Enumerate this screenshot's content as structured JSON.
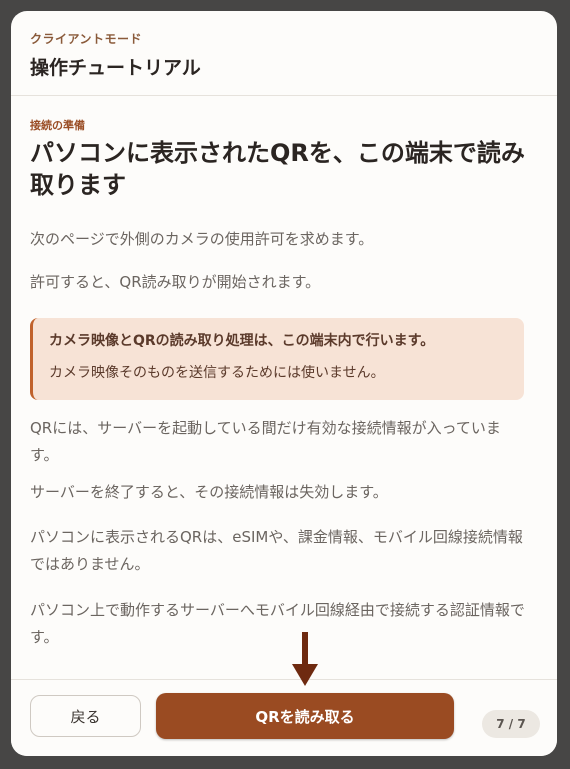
{
  "header": {
    "mode_label": "クライアントモード",
    "title": "操作チュートリアル"
  },
  "step": {
    "label": "接続の準備",
    "title": "パソコンに表示されたQRを、この端末で読み取ります",
    "paragraphs": [
      "次のページで外側のカメラの使用許可を求めます。",
      "許可すると、QR読み取りが開始されます。"
    ],
    "callout": {
      "strong": "カメラ映像とQRの読み取り処理は、この端末内で行います。",
      "text": "カメラ映像そのものを送信するためには使いません。"
    },
    "details": [
      "QRには、サーバーを起動している間だけ有効な接続情報が入っています。",
      "サーバーを終了すると、その接続情報は失効します。",
      "パソコンに表示されるQRは、eSIMや、課金情報、モバイル回線接続情報ではありません。",
      "パソコン上で動作するサーバーへモバイル回線経由で接続する認証情報です。"
    ]
  },
  "footer": {
    "back_label": "戻る",
    "primary_label": "QRを読み取る",
    "page_indicator": "7 / 7"
  },
  "colors": {
    "accent": "#9a4b22",
    "callout_bg": "#f7e3d6",
    "callout_border": "#c0622c",
    "arrow": "#6e2a10"
  },
  "icons": {
    "arrow": "down-arrow-icon"
  }
}
